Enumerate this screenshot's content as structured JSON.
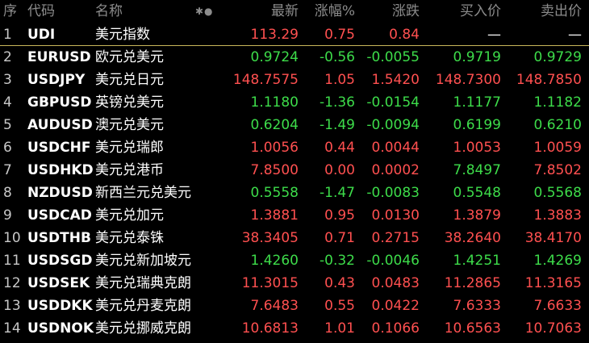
{
  "header": {
    "seq": "序",
    "code": "代码",
    "name": "名称",
    "tool": "✱●",
    "last": "最新",
    "pct": "涨幅%",
    "chg": "涨跌",
    "bid": "买入价",
    "ask": "卖出价"
  },
  "colors": {
    "up": "#ff5050",
    "down": "#3ddc4a",
    "separator": "#c8b65a",
    "background": "#000000"
  },
  "rows": [
    {
      "seq": "1",
      "code": "UDI",
      "name": "美元指数",
      "last": "113.29",
      "pct": "0.75",
      "chg": "0.84",
      "bid": "—",
      "ask": "—",
      "dir": "up"
    },
    {
      "seq": "2",
      "code": "EURUSD",
      "name": "欧元兑美元",
      "last": "0.9724",
      "pct": "-0.56",
      "chg": "-0.0055",
      "bid": "0.9719",
      "ask": "0.9729",
      "dir": "down"
    },
    {
      "seq": "3",
      "code": "USDJPY",
      "name": "美元兑日元",
      "last": "148.7575",
      "pct": "1.05",
      "chg": "1.5420",
      "bid": "148.7300",
      "ask": "148.7850",
      "dir": "up"
    },
    {
      "seq": "4",
      "code": "GBPUSD",
      "name": "英镑兑美元",
      "last": "1.1180",
      "pct": "-1.36",
      "chg": "-0.0154",
      "bid": "1.1177",
      "ask": "1.1182",
      "dir": "down"
    },
    {
      "seq": "5",
      "code": "AUDUSD",
      "name": "澳元兑美元",
      "last": "0.6204",
      "pct": "-1.49",
      "chg": "-0.0094",
      "bid": "0.6199",
      "ask": "0.6210",
      "dir": "down"
    },
    {
      "seq": "6",
      "code": "USDCHF",
      "name": "美元兑瑞郎",
      "last": "1.0056",
      "pct": "0.44",
      "chg": "0.0044",
      "bid": "1.0053",
      "ask": "1.0059",
      "dir": "up"
    },
    {
      "seq": "7",
      "code": "USDHKD",
      "name": "美元兑港币",
      "last": "7.8500",
      "pct": "0.00",
      "chg": "0.0002",
      "bid": "7.8497",
      "ask": "7.8502",
      "dir": "up",
      "bid_dir": "down"
    },
    {
      "seq": "8",
      "code": "NZDUSD",
      "name": "新西兰元兑美元",
      "last": "0.5558",
      "pct": "-1.47",
      "chg": "-0.0083",
      "bid": "0.5548",
      "ask": "0.5568",
      "dir": "down"
    },
    {
      "seq": "9",
      "code": "USDCAD",
      "name": "美元兑加元",
      "last": "1.3881",
      "pct": "0.95",
      "chg": "0.0130",
      "bid": "1.3879",
      "ask": "1.3883",
      "dir": "up"
    },
    {
      "seq": "10",
      "code": "USDTHB",
      "name": "美元兑泰铢",
      "last": "38.3405",
      "pct": "0.71",
      "chg": "0.2715",
      "bid": "38.2640",
      "ask": "38.4170",
      "dir": "up"
    },
    {
      "seq": "11",
      "code": "USDSGD",
      "name": "美元兑新加坡元",
      "last": "1.4260",
      "pct": "-0.32",
      "chg": "-0.0046",
      "bid": "1.4251",
      "ask": "1.4269",
      "dir": "down"
    },
    {
      "seq": "12",
      "code": "USDSEK",
      "name": "美元兑瑞典克朗",
      "last": "11.3015",
      "pct": "0.43",
      "chg": "0.0483",
      "bid": "11.2865",
      "ask": "11.3165",
      "dir": "up"
    },
    {
      "seq": "13",
      "code": "USDDKK",
      "name": "美元兑丹麦克朗",
      "last": "7.6483",
      "pct": "0.55",
      "chg": "0.0422",
      "bid": "7.6333",
      "ask": "7.6633",
      "dir": "up"
    },
    {
      "seq": "14",
      "code": "USDNOK",
      "name": "美元兑挪威克朗",
      "last": "10.6813",
      "pct": "1.01",
      "chg": "0.1066",
      "bid": "10.6563",
      "ask": "10.7063",
      "dir": "up"
    }
  ]
}
